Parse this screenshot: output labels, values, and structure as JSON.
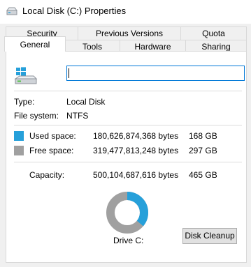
{
  "window": {
    "title": "Local Disk (C:) Properties",
    "icon": "drive-icon"
  },
  "tabs_row1": [
    "Security",
    "Previous Versions",
    "Quota"
  ],
  "tabs_row2": [
    "General",
    "Tools",
    "Hardware",
    "Sharing"
  ],
  "active_tab": "General",
  "general": {
    "name_value": "",
    "type_label": "Type:",
    "type_value": "Local Disk",
    "fs_label": "File system:",
    "fs_value": "NTFS",
    "used_label": "Used space:",
    "used_bytes": "180,626,874,368 bytes",
    "used_gb": "168 GB",
    "free_label": "Free space:",
    "free_bytes": "319,477,813,248 bytes",
    "free_gb": "297 GB",
    "capacity_label": "Capacity:",
    "capacity_bytes": "500,104,687,616 bytes",
    "capacity_gb": "465 GB",
    "drive_label": "Drive C:",
    "cleanup_label": "Disk Cleanup"
  },
  "usage": {
    "used_fraction": 0.361,
    "used_color": "#26a0da",
    "free_color": "#a0a0a0"
  }
}
